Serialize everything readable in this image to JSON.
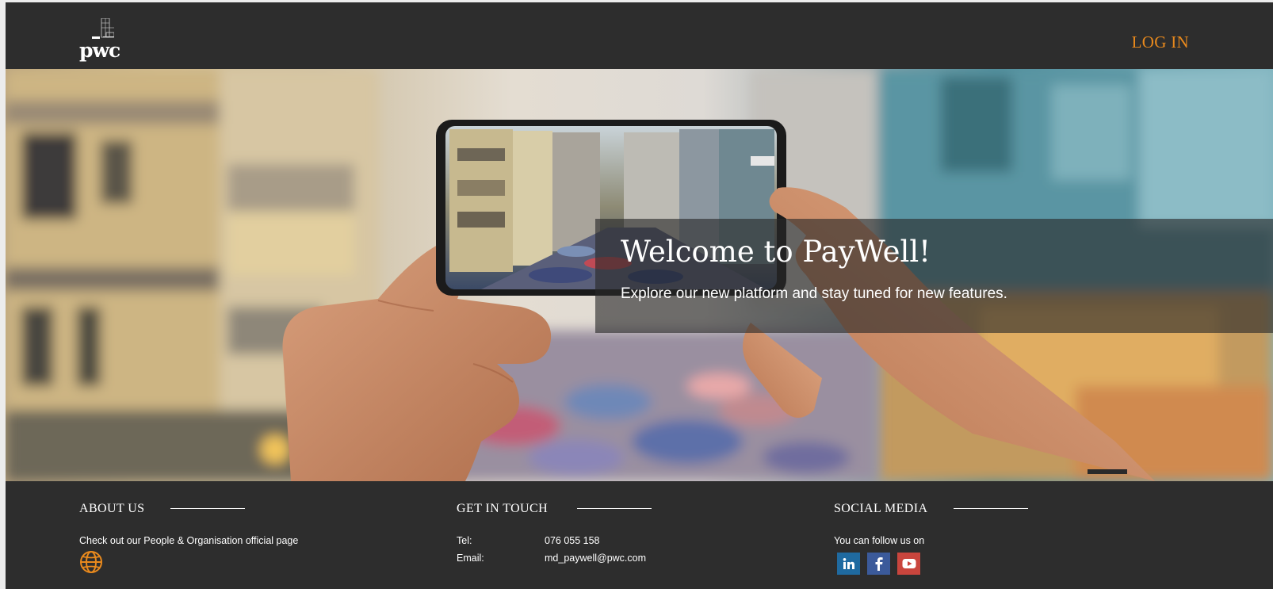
{
  "header": {
    "logo_text": "pwc",
    "login_label": "LOG IN"
  },
  "hero": {
    "title": "Welcome to PayWell!",
    "subtitle": "Explore our new platform and stay tuned for new features."
  },
  "footer": {
    "about": {
      "heading": "ABOUT US",
      "text": "Check out our People & Organisation official page",
      "icon": "globe-icon"
    },
    "contact": {
      "heading": "GET IN TOUCH",
      "rows": [
        {
          "label": "Tel:",
          "value": "076 055 158"
        },
        {
          "label": "Email:",
          "value": "md_paywell@pwc.com"
        }
      ]
    },
    "social": {
      "heading": "SOCIAL MEDIA",
      "text": "You can follow us on",
      "icons": [
        "linkedin-icon",
        "facebook-icon",
        "youtube-icon"
      ]
    }
  },
  "colors": {
    "background": "#2d2d2d",
    "accent": "#e8891d",
    "linkedin": "#1f6aa0",
    "facebook": "#3b5a9a",
    "youtube": "#c9453d"
  }
}
